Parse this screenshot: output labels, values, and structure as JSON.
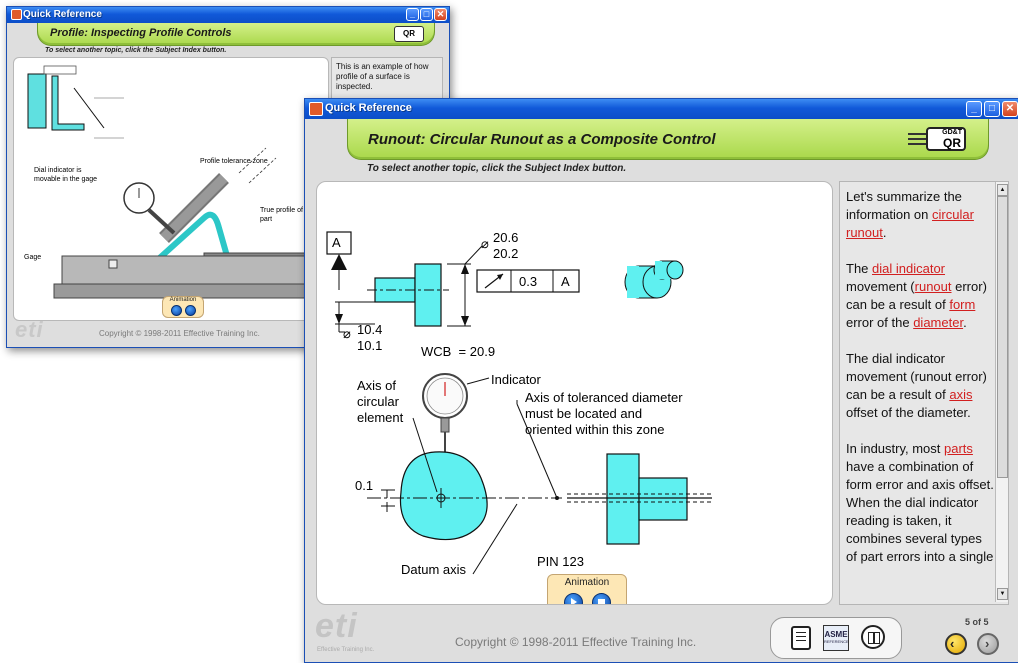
{
  "back_window": {
    "title": "Quick Reference",
    "header_title": "Profile: Inspecting Profile Controls",
    "subtitle": "To select another topic, click the Subject Index button.",
    "side_text": "This is an example of how profile of a surface is inspected.",
    "diagram_labels": {
      "dial_indicator": "Dial indicator is movable in the gage",
      "tolerance_zone": "Profile tolerance zone",
      "true_profile": "True profile of part",
      "gage": "Gage"
    },
    "animation_label": "Animation",
    "copyright": "Copyright © 1998-2011 Effective Training Inc.",
    "logo_text": "eti"
  },
  "front_window": {
    "title": "Quick Reference",
    "header_title": "Runout: Circular Runout as a Composite Control",
    "badge": {
      "top": "GD&T",
      "bottom": "QR"
    },
    "subtitle": "To select another topic, click the Subject Index button.",
    "diagram_labels": {
      "datum": "A",
      "dim_top_1": "20.6",
      "dim_top_2": "20.2",
      "fcf_value": "0.3",
      "fcf_datum": "A",
      "dim_bot_1": "10.4",
      "dim_bot_2": "10.1",
      "wcb": "WCB  = 20.9",
      "axis_circ_1": "Axis of",
      "axis_circ_2": "circular",
      "axis_circ_3": "element",
      "indicator": "Indicator",
      "tol_axis_1": "Axis of toleranced diameter",
      "tol_axis_2": "must be located and",
      "tol_axis_3": "oriented within this zone",
      "offset": "0.1",
      "datum_axis": "Datum axis",
      "pin": "PIN 123"
    },
    "animation_label": "Animation",
    "side_paragraphs": [
      [
        {
          "t": "Let's summarize the information on "
        },
        {
          "t": "circular runout",
          "link": true
        },
        {
          "t": "."
        }
      ],
      [
        {
          "t": "The "
        },
        {
          "t": "dial indicator",
          "link": true
        },
        {
          "t": " movement ("
        },
        {
          "t": "runout",
          "link": true
        },
        {
          "t": " error) can be a result of "
        },
        {
          "t": "form",
          "link": true
        },
        {
          "t": " error of the "
        },
        {
          "t": "diameter",
          "link": true
        },
        {
          "t": "."
        }
      ],
      [
        {
          "t": "The dial indicator movement (runout error) can be a result of "
        },
        {
          "t": "axis",
          "link": true
        },
        {
          "t": " offset of the diameter."
        }
      ],
      [
        {
          "t": "In industry, most "
        },
        {
          "t": "parts",
          "link": true
        },
        {
          "t": " have a combination of form error and axis offset. When the dial indicator reading is taken, it combines several types of part errors into a single"
        }
      ]
    ],
    "copyright": "Copyright © 1998-2011 Effective Training Inc.",
    "logo_text": "eti",
    "logo_sub": "Effective Training Inc.",
    "page_counter": "5 of 5",
    "asme_label": "ASME",
    "asme_sub": "REFERENCE"
  },
  "colors": {
    "part_fill": "#5ff0f0",
    "header_green": "#b6e05a",
    "link_red": "#d21f1f",
    "titlebar_blue": "#1159d9"
  }
}
